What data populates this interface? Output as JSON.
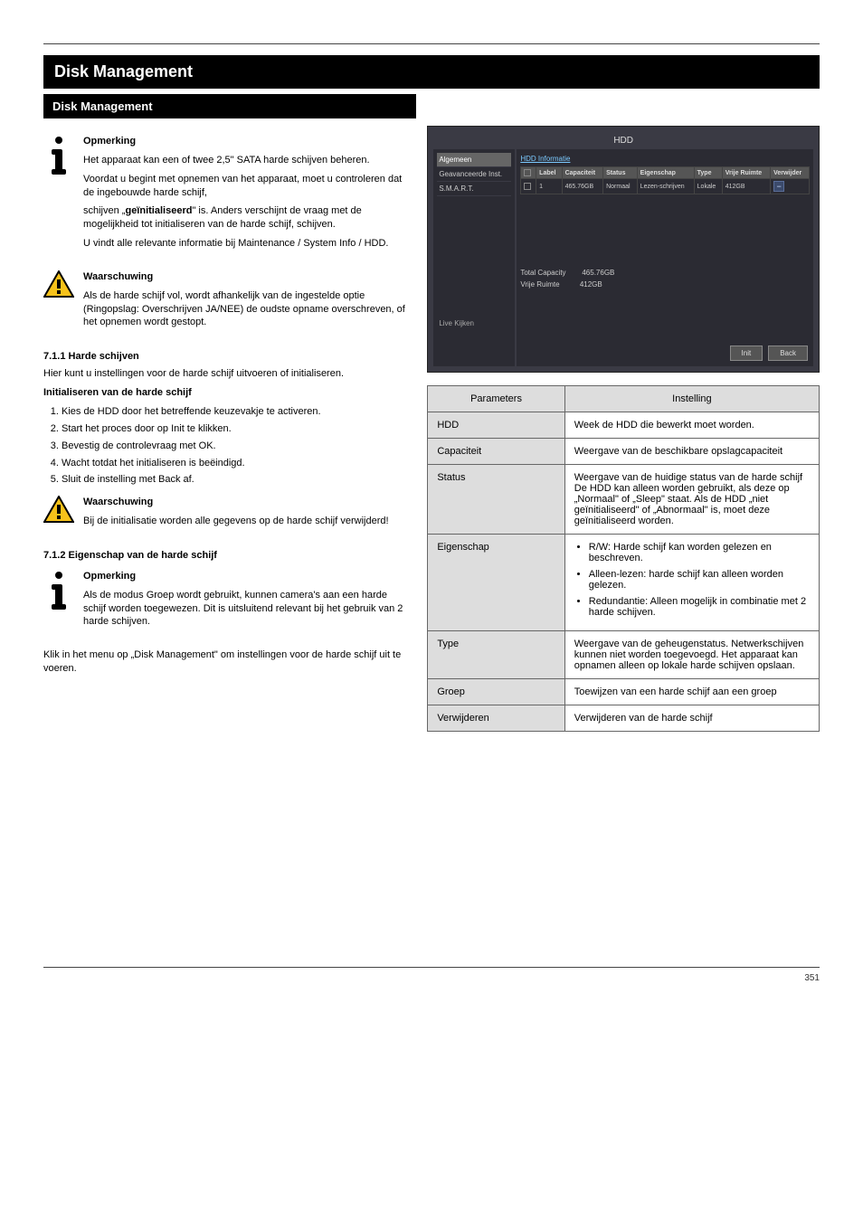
{
  "banner": "Disk Management",
  "sub_banner": "Disk Management",
  "note1": {
    "p1": "Opmerking",
    "p2": "Het apparaat kan een of twee 2,5\" SATA harde schijven beheren.",
    "p3": "Voordat u begint met opnemen van het apparaat, moet u controleren dat de ingebouwde harde schijf,",
    "p4_pre": "schijven „",
    "p4_mid": "geïnitialiseerd",
    "p4_post": "\" is. Anders verschijnt de vraag met de mogelijkheid tot initialiseren van de harde schijf, schijven.",
    "p5": "U vindt alle relevante informatie bij Maintenance / System Info / HDD."
  },
  "warn1": {
    "p1": "Waarschuwing",
    "p2": "Als de harde schijf vol, wordt afhankelijk van de ingestelde optie (Ringopslag: Overschrijven JA/NEE) de oudste opname overschreven, of het opnemen wordt gestopt."
  },
  "heading_hdd": "7.1.1 Harde schijven",
  "hdd_text": {
    "p1": "Hier kunt u instellingen voor de harde schijf uitvoeren of initialiseren.",
    "p2": "Initialiseren van de harde schijf",
    "l1": "Kies de HDD door het betreffende keuzevakje te activeren.",
    "l2": "Start het proces door op Init te klikken.",
    "l3": "Bevestig de controlevraag met OK.",
    "l4": "Wacht totdat het initialiseren is beëindigd.",
    "l5": "Sluit de instelling met Back af."
  },
  "warn2": {
    "p1": "Waarschuwing",
    "p2": "Bij de initialisatie worden alle gegevens op de harde schijf verwijderd!"
  },
  "heading_prop": "7.1.2 Eigenschap van de harde schijf",
  "note2": {
    "p1": "Opmerking",
    "p2": "Als de modus Groep wordt gebruikt, kunnen camera's aan een harde schijf worden toegewezen. Dit is uitsluitend relevant bij het gebruik van 2 harde schijven."
  },
  "dm_p1_pre": "Klik in het menu op „Disk Management\" om instellingen",
  "dm_p1_post": "voor de harde schijf uit te voeren.",
  "screenshot": {
    "window_title": "HDD",
    "sidebar": {
      "item1": "Algemeen",
      "item2": "Geavanceerde Inst.",
      "item3": "S.M.A.R.T.",
      "live": "Live Kijken"
    },
    "tab": "HDD Informatie",
    "th": {
      "chk": "",
      "label": "Label",
      "cap": "Capaciteit",
      "status": "Status",
      "eig": "Eigenschap",
      "type": "Type",
      "vrij": "Vrije Ruimte",
      "verw": "Verwijder"
    },
    "row": {
      "label": "1",
      "cap": "465.76GB",
      "status": "Normaal",
      "eig": "Lezen-schrijven",
      "type": "Lokale",
      "vrij": "412GB"
    },
    "info": {
      "tc_label": "Total Capacity",
      "tc_val": "465.76GB",
      "fr_label": "Vrije Ruimte",
      "fr_val": "412GB"
    },
    "btn_init": "Init",
    "btn_back": "Back"
  },
  "table": {
    "h1": "Parameters",
    "h2": "Instelling",
    "r1a": "HDD",
    "r1b": "Week de HDD die bewerkt moet worden.",
    "r2a": "Capaciteit",
    "r2b": "Weergave van de beschikbare opslagcapaciteit",
    "r3a": "Status",
    "r3b": "Weergave van de huidige status van de harde schijf De HDD kan alleen worden gebruikt, als deze op „Normaal\" of „Sleep\" staat. Als de HDD „niet geïnitialiseerd\" of „Abnormaal\" is, moet deze geïnitialiseerd worden.",
    "r4a": "Eigenschap",
    "r4b1": "R/W: Harde schijf kan worden gelezen en beschreven.",
    "r4b2": "Alleen-lezen: harde schijf kan alleen worden gelezen.",
    "r4b3": "Redundantie: Alleen mogelijk in combinatie met 2 harde schijven.",
    "r5a": "Type",
    "r5b": "Weergave van de geheugenstatus. Netwerkschijven kunnen niet worden toegevoegd. Het apparaat kan opnamen alleen op lokale harde schijven opslaan.",
    "r6a": "Groep",
    "r6b": "Toewijzen van een harde schijf aan een groep",
    "r7a": "Verwijderen",
    "r7b": "Verwijderen van de harde schijf"
  },
  "page_no": "351"
}
